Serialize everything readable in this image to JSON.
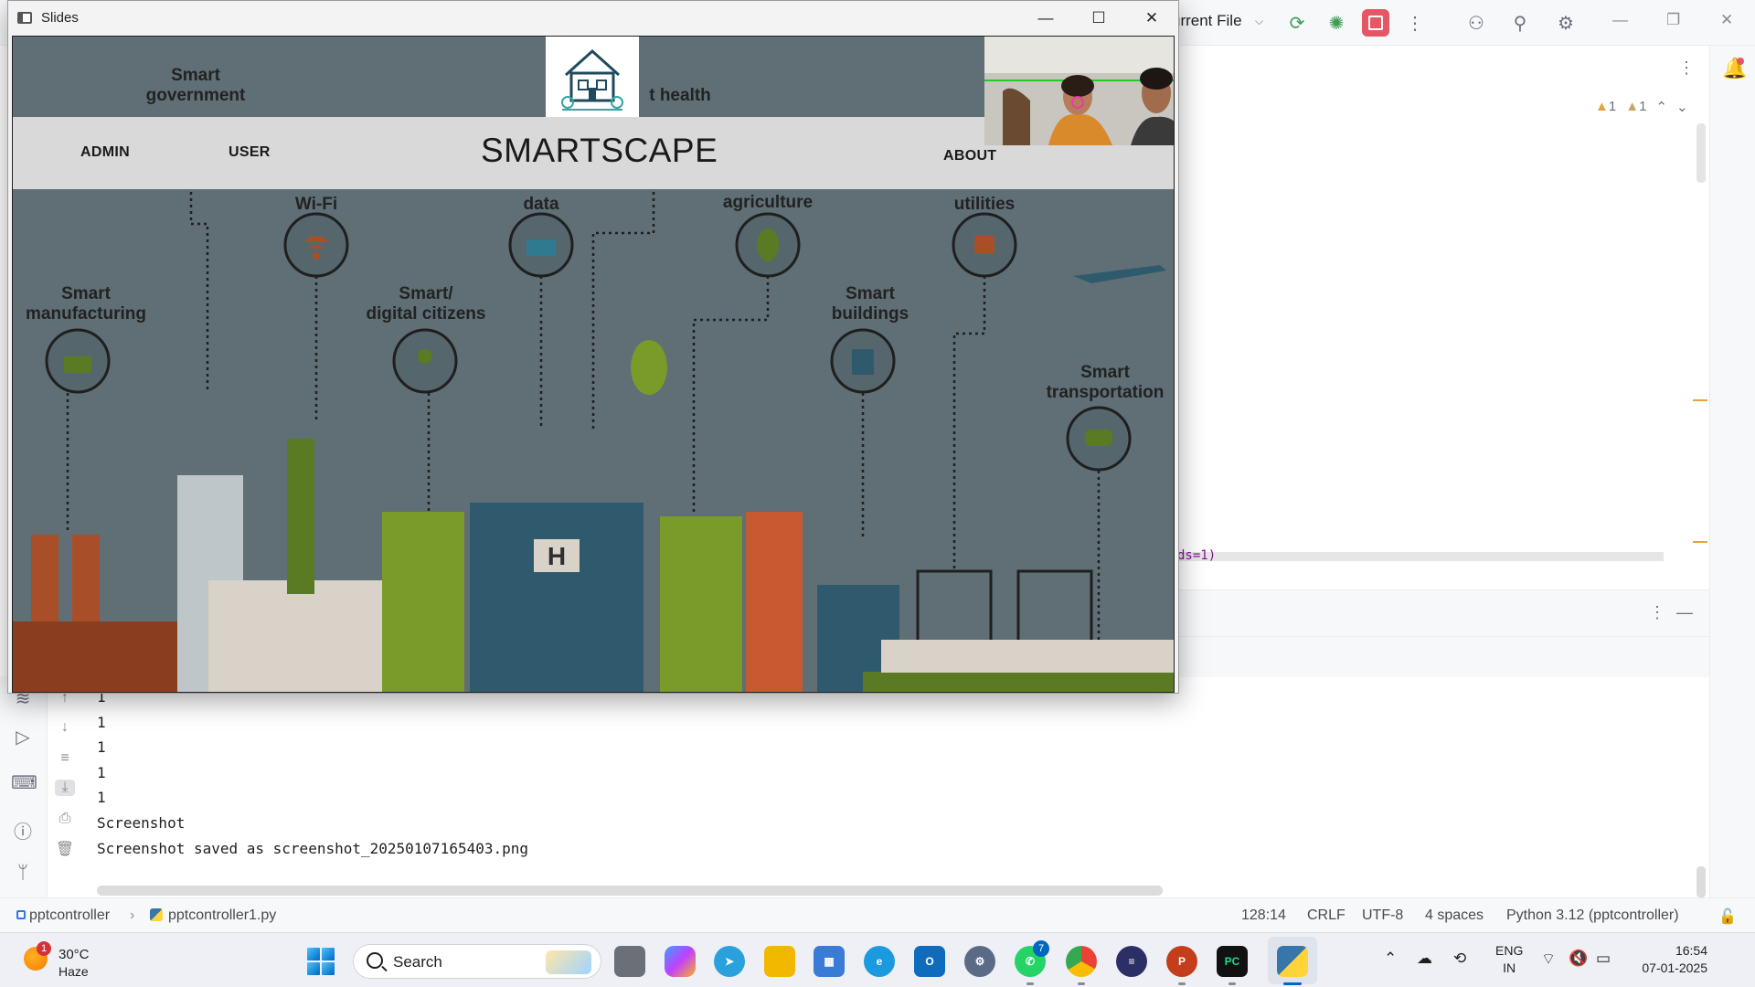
{
  "ide": {
    "run_config": "urrent File",
    "warnings": {
      "warn_count": "1",
      "weak_warn_count": "1"
    },
    "code_fragment": "ds=1)",
    "console_lines": [
      "1",
      "1",
      "1",
      "1",
      "1",
      "Screenshot",
      "Screenshot saved as screenshot_20250107165403.png"
    ],
    "status": {
      "project": "pptcontroller",
      "file": "pptcontroller1.py",
      "position": "128:14",
      "line_ending": "CRLF",
      "encoding": "UTF-8",
      "indent": "4 spaces",
      "interpreter": "Python 3.12 (pptcontroller)"
    }
  },
  "slides_window": {
    "title": "Slides",
    "nav": {
      "admin": "ADMIN",
      "user": "USER",
      "brand": "SMARTSCAPE",
      "about": "ABOUT"
    },
    "scene_labels": {
      "smart_government": "Smart government",
      "health": "t health",
      "wifi": "Wi-Fi",
      "data": "data",
      "agriculture": "agriculture",
      "utilities": "utilities",
      "manufacturing": "Smart manufacturing",
      "citizens": "Smart/ digital citizens",
      "buildings": "Smart buildings",
      "transportation": "Smart transportation"
    }
  },
  "taskbar": {
    "weather": {
      "temp": "30°C",
      "desc": "Haze",
      "badge": "1"
    },
    "search_label": "Search",
    "whatsapp_badge": "7",
    "lang_top": "ENG",
    "lang_bottom": "IN",
    "time": "16:54",
    "date": "07-01-2025"
  },
  "colors": {
    "accent": "#0067c0",
    "stop_button": "#e55765",
    "scene_bg": "#5f6f75"
  }
}
